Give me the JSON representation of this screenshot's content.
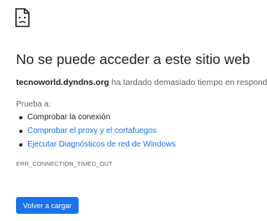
{
  "icon": "sad-page-icon",
  "heading": "No se puede acceder a este sitio web",
  "summary": {
    "host": "tecnoworld.dyndns.org",
    "message": " ha tardado demasiado tiempo en responder."
  },
  "suggestions": {
    "heading": "Prueba a:",
    "items": [
      {
        "label": "Comprobar la conexión",
        "link": false
      },
      {
        "label": "Comprobar el proxy y el cortafuegos",
        "link": true
      },
      {
        "label": "Ejecutar Diagnósticos de red de Windows",
        "link": true
      }
    ]
  },
  "error_code": "ERR_CONNECTION_TIMED_OUT",
  "reload_button": "Volver a cargar",
  "colors": {
    "link": "#1a73e8",
    "button": "#1a73e8",
    "text": "#202124",
    "secondary_text": "#5f6368"
  }
}
